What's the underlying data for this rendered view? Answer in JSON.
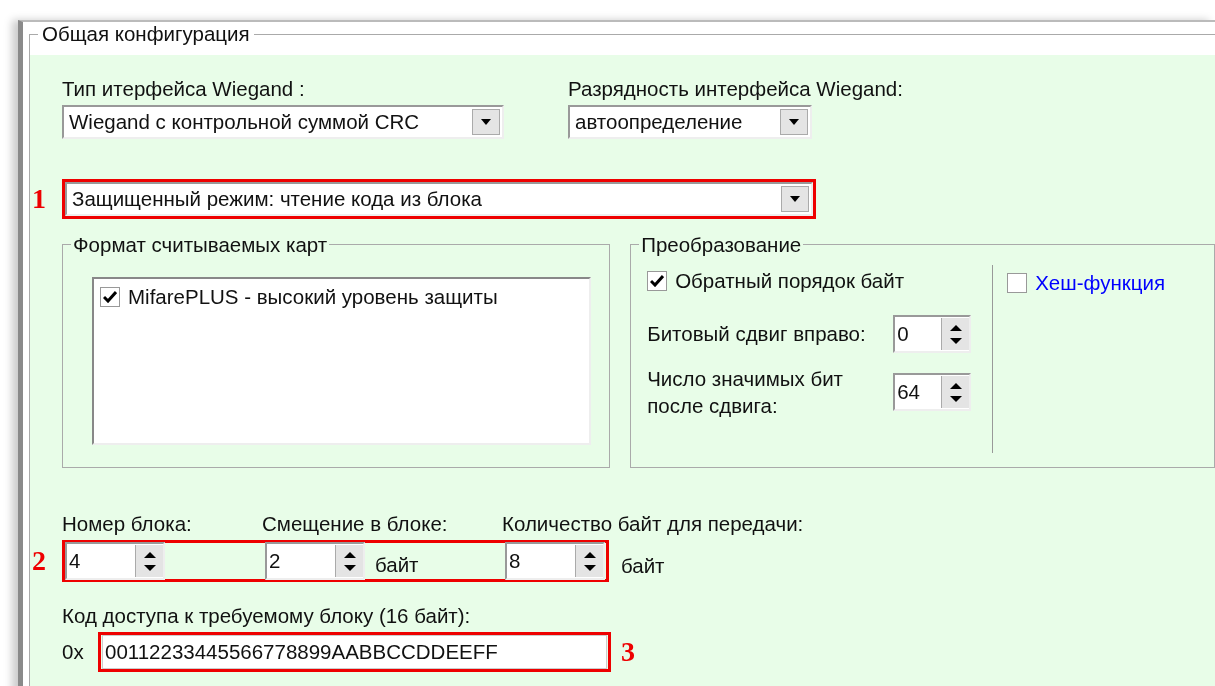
{
  "group": {
    "title": "Общая конфигурация"
  },
  "interface_type": {
    "label": "Тип итерфейса Wiegand :",
    "value": "Wiegand с контрольной суммой CRC"
  },
  "interface_width": {
    "label": "Разрядность интерфейса Wiegand:",
    "value": "автоопределение"
  },
  "mode": {
    "value": "Защищенный режим: чтение кода из блока",
    "callout": "1"
  },
  "card_formats": {
    "title": "Формат считываемых карт",
    "items": [
      {
        "label": "MifarePLUS - высокий уровень защиты",
        "checked": true
      }
    ]
  },
  "transform": {
    "title": "Преобразование",
    "reverse_bytes": {
      "label": "Обратный порядок байт",
      "checked": true
    },
    "hash": {
      "label": "Хеш-функция",
      "checked": false
    },
    "shift": {
      "label": "Битовый сдвиг вправо:",
      "value": "0"
    },
    "bits": {
      "label_lines": [
        "Число значимых бит",
        "после сдвига:"
      ],
      "value": "64"
    }
  },
  "block_row": {
    "callout": "2",
    "fields": [
      {
        "label": "Номер блока:",
        "value": "4"
      },
      {
        "label": "Смещение в блоке:",
        "value": "2",
        "unit": "байт"
      },
      {
        "label": "Количество байт для передачи:",
        "value": "8",
        "unit": "байт"
      }
    ]
  },
  "access_code": {
    "label": "Код доступа к требуемому блоку (16 байт):",
    "prefix": "0x",
    "value": "00112233445566778899AABBCCDDEEFF",
    "callout": "3"
  }
}
